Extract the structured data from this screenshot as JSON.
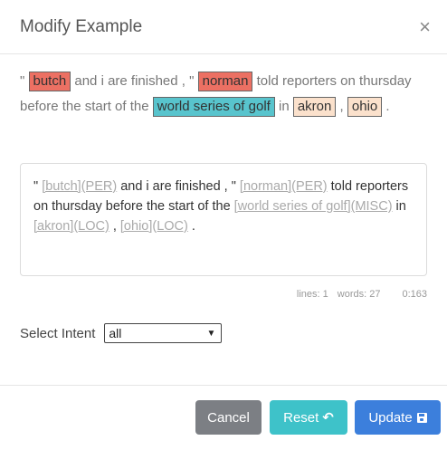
{
  "modal": {
    "title": "Modify Example",
    "close": "×"
  },
  "preview": {
    "t1": "\" ",
    "e1": "butch",
    "t2": " and i are finished , \" ",
    "e2": "norman",
    "t3": " told reporters on thursday before the start of the ",
    "e3": "world series of golf",
    "t4": " in ",
    "e4": "akron",
    "t5": " , ",
    "e5": "ohio",
    "t6": " ."
  },
  "editor": {
    "s1": "\" ",
    "m1": "[butch](PER)",
    "s2": " and i are finished , \" ",
    "m2": "[norman](PER)",
    "s3": " told reporters on thursday before the start of the ",
    "m3": "[world series of golf](MISC)",
    "s4": " in ",
    "m4": "[akron](LOC)",
    "s5": " , ",
    "m5": "[ohio](LOC)",
    "s6": " ."
  },
  "stats": {
    "lines": "lines: 1",
    "words": "words: 27",
    "position": "0:163"
  },
  "intent": {
    "label": "Select Intent",
    "selected": "all"
  },
  "buttons": {
    "cancel": "Cancel",
    "reset": "Reset",
    "update": "Update"
  },
  "colors": {
    "per": "#ec7063",
    "misc": "#58c4cd",
    "loc": "#fbe1cc",
    "update": "#3c7fdc",
    "reset": "#3ec2c9",
    "cancel": "#7c7f84"
  }
}
